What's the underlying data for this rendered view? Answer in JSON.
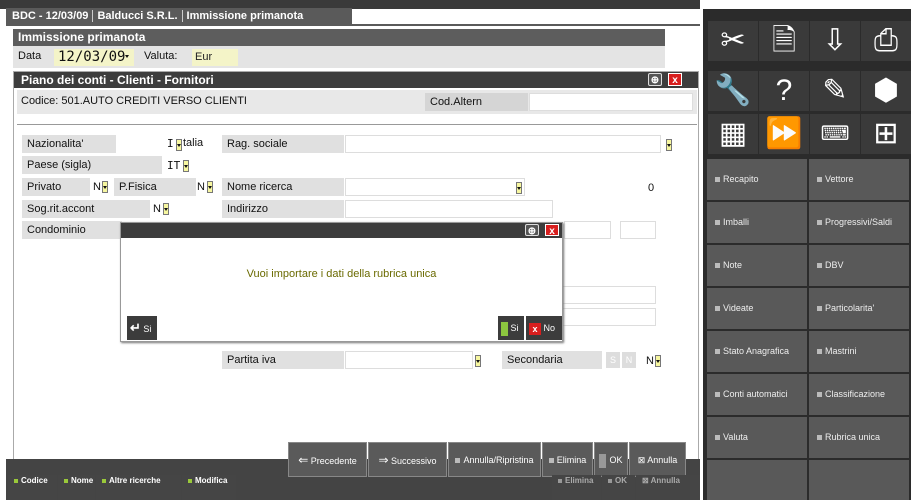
{
  "tabs": {
    "app": "BDC - 12/03/09",
    "company": "Balducci S.R.L.",
    "current": "Immissione primanota"
  },
  "header": {
    "title": "Immissione primanota",
    "data_label": "Data",
    "data_value": "12/03/09",
    "valuta_label": "Valuta:",
    "valuta_value": "Eur"
  },
  "window": {
    "title": "Piano dei conti - Clienti - Fornitori",
    "codice": "Codice: 501.AUTO CREDITI VERSO CLIENTI",
    "cod_altern_label": "Cod.Altern",
    "fields": {
      "nazionalita_label": "Nazionalita'",
      "nazionalita_value": "I",
      "nazionalita_text": "talia",
      "paese_label": "Paese (sigla)",
      "paese_value": "IT",
      "privato_label": "Privato",
      "privato_value": "N",
      "pfisica_label": "P.Fisica",
      "pfisica_value": "N",
      "sogrit_label": "Sog.rit.accont",
      "sogrit_value": "N",
      "condominio_label": "Condominio",
      "rag_sociale_label": "Rag. sociale",
      "nome_ricerca_label": "Nome ricerca",
      "nome_ricerca_count": "0",
      "indirizzo_label": "Indirizzo",
      "partita_iva_label": "Partita iva",
      "secondaria_label": "Secondaria",
      "secondaria_s": "S",
      "secondaria_n": "N",
      "secondaria_value": "N"
    }
  },
  "dialog": {
    "message": "Vuoi importare i dati della rubrica unica",
    "enter_label": "Si",
    "si_label": "Si",
    "no_label": "No"
  },
  "bottom_buttons": {
    "precedente": "Precedente",
    "successivo": "Successivo",
    "annulla_ripristina": "Annulla/Ripristina",
    "elimina": "Elimina",
    "ok": "OK",
    "annulla": "Annulla"
  },
  "fkeys": {
    "codice": "Codice",
    "nome": "Nome",
    "altre": "Altre ricerche",
    "modifica": "Modifica",
    "elimina": "Elimina",
    "ok": "OK",
    "annulla": "Annulla"
  },
  "side_buttons": {
    "recapito": "Recapito",
    "vettore": "Vettore",
    "imballi": "Imballi",
    "progressivi": "Progressivi/Saldi",
    "note": "Note",
    "dbv": "DBV",
    "videate": "Videate",
    "particolarita": "Particolarita'",
    "stato": "Stato Anagrafica",
    "mastrini": "Mastrini",
    "conti_auto": "Conti automatici",
    "classificazione": "Classificazione",
    "valuta": "Valuta",
    "rubrica": "Rubrica unica"
  },
  "colors": {
    "accent_green": "#8cc63f",
    "close_red": "#d81e1e",
    "field_yellow": "#f4f4c8",
    "dialog_text": "#6a6a00"
  }
}
